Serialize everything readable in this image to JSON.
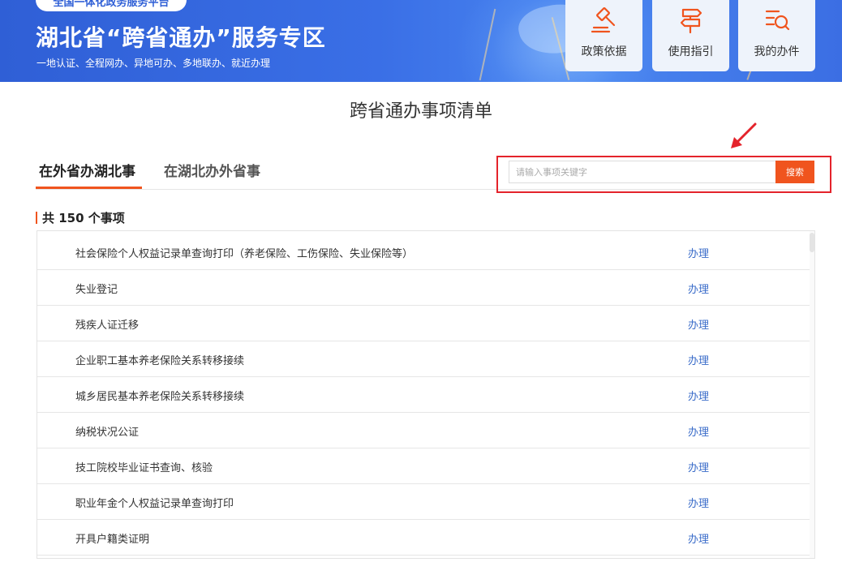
{
  "header": {
    "top_pill": "全国一体化政务服务平台",
    "title": "湖北省“跨省通办”服务专区",
    "subtitle": "一地认证、全程网办、异地可办、多地联办、就近办理",
    "quick_buttons": [
      {
        "label": "政策依据",
        "icon": "gavel-icon"
      },
      {
        "label": "使用指引",
        "icon": "signpost-icon"
      },
      {
        "label": "我的办件",
        "icon": "list-search-icon"
      }
    ]
  },
  "page_title": "跨省通办事项清单",
  "tabs": [
    {
      "label": "在外省办湖北事",
      "active": true
    },
    {
      "label": "在湖北办外省事",
      "active": false
    }
  ],
  "search": {
    "placeholder": "请输入事项关键字",
    "value": "",
    "button_label": "搜索"
  },
  "count": {
    "prefix": "共",
    "number": "150",
    "suffix": "个事项"
  },
  "items": [
    {
      "name": "社会保险个人权益记录单查询打印（养老保险、工伤保险、失业保险等）",
      "action": "办理"
    },
    {
      "name": "失业登记",
      "action": "办理"
    },
    {
      "name": "残疾人证迁移",
      "action": "办理"
    },
    {
      "name": "企业职工基本养老保险关系转移接续",
      "action": "办理"
    },
    {
      "name": "城乡居民基本养老保险关系转移接续",
      "action": "办理"
    },
    {
      "name": "纳税状况公证",
      "action": "办理"
    },
    {
      "name": "技工院校毕业证书查询、核验",
      "action": "办理"
    },
    {
      "name": "职业年金个人权益记录单查询打印",
      "action": "办理"
    },
    {
      "name": "开具户籍类证明",
      "action": "办理"
    }
  ],
  "colors": {
    "banner_blue": "#3a6fe6",
    "accent_orange": "#f0541e",
    "highlight_red": "#e4232b",
    "link_blue": "#3a6cc9"
  }
}
